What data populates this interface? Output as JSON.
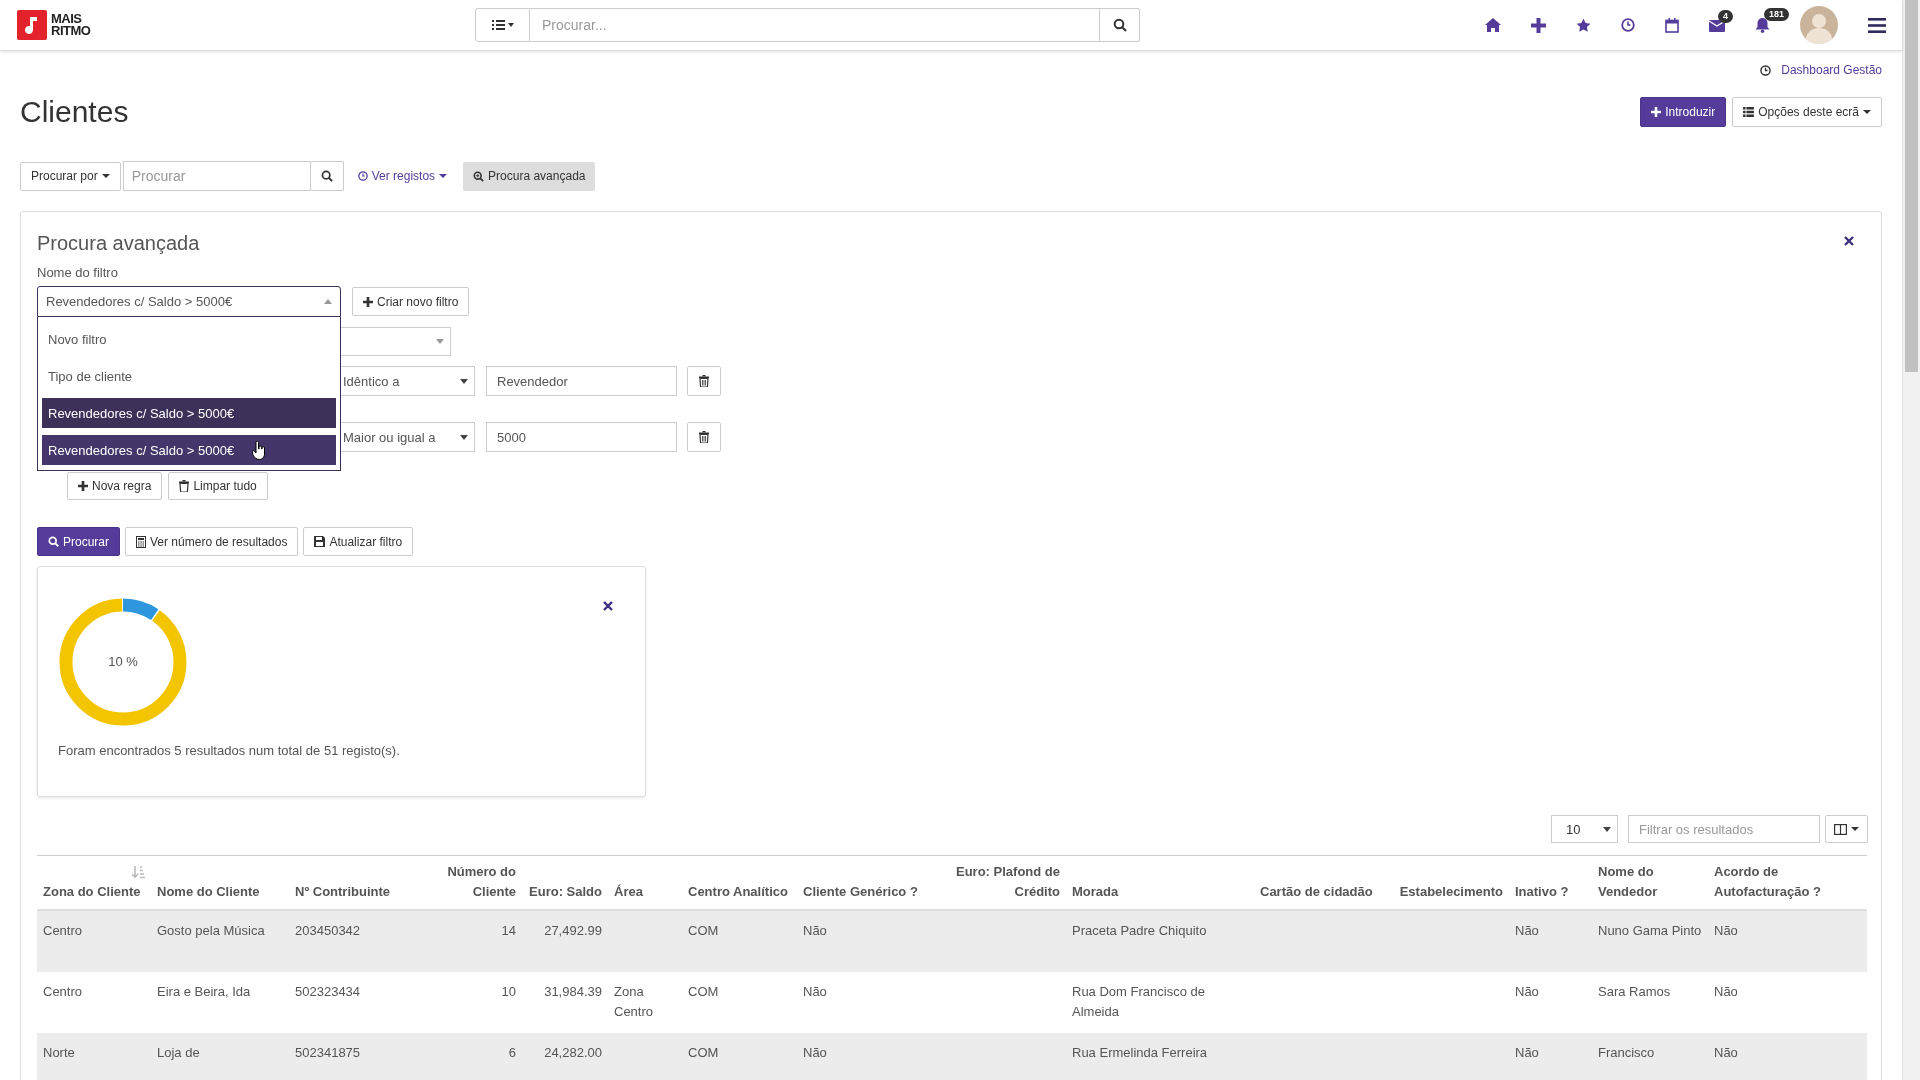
{
  "topbar": {
    "logo_line1": "MAIS",
    "logo_line2": "RITMO",
    "search": {
      "placeholder": "Procurar..."
    },
    "mail_badge": "4",
    "notifications_badge": "181"
  },
  "dashboard_link": "Dashboard Gestão",
  "title": "Clientes",
  "actions": {
    "introduzir": "Introduzir",
    "options": "Opções deste ecrã"
  },
  "search_bar": {
    "search_by": "Procurar por",
    "placeholder": "Procurar",
    "view_records": "Ver registos",
    "advanced": "Procura avançada",
    "advanced_selected": true
  },
  "advanced_search": {
    "title": "Procura avançada",
    "filter_name_label": "Nome do filtro",
    "filter_value": "Revendedores c/ Saldo > 5000€",
    "expanded": true,
    "new_filter": "Criar novo filtro",
    "options": [
      {
        "label": "Novo filtro",
        "selected": false,
        "hovered": false
      },
      {
        "label": "Tipo de cliente",
        "selected": false,
        "hovered": false
      },
      {
        "label": "Revendedores c/ Saldo > 5000€",
        "selected": true,
        "hovered": false
      },
      {
        "label": "Revendedores c/ Saldo > 5000€",
        "selected": false,
        "hovered": true
      }
    ],
    "rules": [
      {
        "operator": "Idêntico a",
        "value": "Revendedor"
      },
      {
        "operator": "Maior ou igual a",
        "value": "5000"
      }
    ],
    "new_rule": "Nova regra",
    "clear_all": "Limpar tudo",
    "search": "Procurar",
    "count": "Ver número de resultados",
    "update": "Atualizar filtro"
  },
  "result": {
    "level": 0.098,
    "percent": "10 %",
    "message": "Foram encontrados 5 resultados num total de 51 registo(s)."
  },
  "table": {
    "page_size": "10",
    "filter_placeholder": "Filtrar os resultados",
    "columns": [
      {
        "label": "Zona do Cliente",
        "numeric": false,
        "sorted": true
      },
      {
        "label": "Nome do Cliente",
        "numeric": false,
        "sorted": false
      },
      {
        "label": "Nº Contribuinte",
        "numeric": false,
        "sorted": false
      },
      {
        "label": "Número do Cliente",
        "numeric": true,
        "sorted": false
      },
      {
        "label": "Euro: Saldo",
        "numeric": true,
        "sorted": false
      },
      {
        "label": "Área",
        "numeric": false,
        "sorted": false
      },
      {
        "label": "Centro Analítico",
        "numeric": false,
        "sorted": false
      },
      {
        "label": "Cliente Genérico ?",
        "numeric": false,
        "sorted": false
      },
      {
        "label": "Euro: Plafond de Crédito",
        "numeric": true,
        "sorted": false
      },
      {
        "label": "Morada",
        "numeric": false,
        "sorted": false
      },
      {
        "label": "Cartão de cidadão",
        "numeric": false,
        "sorted": false
      },
      {
        "label": "Estabelecimento",
        "numeric": true,
        "sorted": false
      },
      {
        "label": "Inativo ?",
        "numeric": false,
        "sorted": false
      },
      {
        "label": "Nome do Vendedor",
        "numeric": false,
        "sorted": false
      },
      {
        "label": "Acordo de Autofacturação ?",
        "numeric": false,
        "sorted": false
      }
    ],
    "rows": [
      [
        "Centro",
        "Gosto pela Música",
        "203450342",
        "14",
        "27,492.99",
        "",
        "COM",
        "Não",
        "",
        "Praceta Padre Chiquito",
        "",
        "",
        "Não",
        "Nuno Gama Pinto",
        "Não"
      ],
      [
        "Centro",
        "Eira e Beira, Ida",
        "502323434",
        "10",
        "31,984.39",
        "Zona Centro",
        "COM",
        "Não",
        "",
        "Rua Dom Francisco de Almeida",
        "",
        "",
        "Não",
        "Sara Ramos",
        "Não"
      ],
      [
        "Norte",
        "Loja de",
        "502341875",
        "6",
        "24,282.00",
        "",
        "COM",
        "Não",
        "",
        "Rua Ermelinda Ferreira",
        "",
        "",
        "Não",
        "Francisco",
        "Não"
      ]
    ]
  }
}
